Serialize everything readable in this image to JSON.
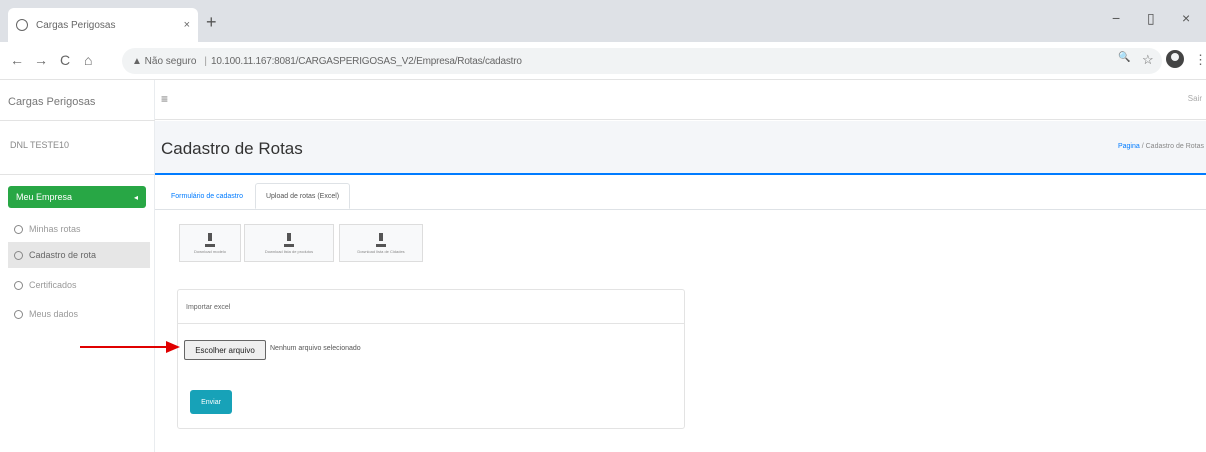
{
  "browser": {
    "tab_title": "Cargas Perigosas",
    "tab_close": "×",
    "new_tab": "+",
    "window_min": "−",
    "window_max": "▯",
    "window_close": "×",
    "nav_back": "←",
    "nav_forward": "→",
    "nav_reload": "C",
    "nav_home": "⌂",
    "security_warning": "▲ Não seguro",
    "url": "10.100.11.167:8081/CARGASPERIGOSAS_V2/Empresa/Rotas/cadastro",
    "zoom_icon": "🔍",
    "star_icon": "☆",
    "menu_icon": "⋮"
  },
  "sidebar": {
    "brand": "Cargas Perigosas",
    "username": "DNL TESTE10",
    "menu_group": "Meu Empresa",
    "menu_group_chevron": "◂",
    "items": [
      {
        "label": "Minhas rotas",
        "selected": false
      },
      {
        "label": "Cadastro de rota",
        "selected": true
      },
      {
        "label": "Certificados",
        "selected": false
      },
      {
        "label": "Meus dados",
        "selected": false
      }
    ]
  },
  "topnav": {
    "hamburger": "≡",
    "right_text": "Sair"
  },
  "page": {
    "title": "Cadastro de Rotas",
    "breadcrumb_link": "Pagina",
    "breadcrumb_sep": "/",
    "breadcrumb_current": "Cadastro de Rotas"
  },
  "tabs": {
    "tab1": "Formulário de cadastro",
    "tab2": "Upload de rotas (Excel)"
  },
  "downloads": [
    {
      "label": "Download modelo"
    },
    {
      "label": "Download lista de produtos"
    },
    {
      "label": "Download lista de Cidades"
    }
  ],
  "import": {
    "header": "Importar excel",
    "file_button": "Escolher arquivo",
    "file_status": "Nenhum arquivo selecionado",
    "submit": "Enviar"
  },
  "colors": {
    "accent": "#007bff",
    "menu_active": "#28a745",
    "submit": "#17a2b8",
    "arrow": "#e00000"
  }
}
